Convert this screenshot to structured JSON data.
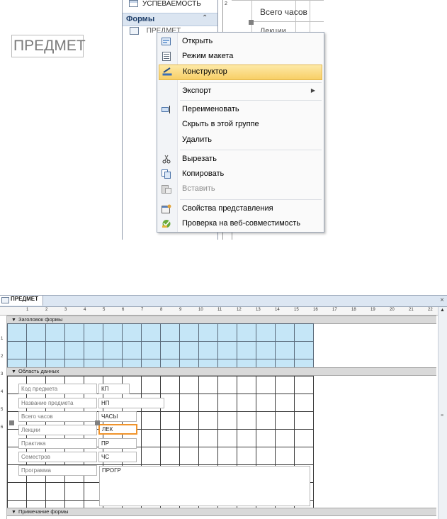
{
  "nav": {
    "table_item": "УСПЕВАЕМОСТЬ",
    "forms_header": "Формы",
    "form_item": "ПРЕДМЕТ",
    "ruler_digit": "2"
  },
  "design_preview": {
    "label_total_hours": "Всего часов",
    "label_lectures": "Лекции"
  },
  "context_menu": {
    "items": [
      {
        "label": "Открыть",
        "icon": "open-form-icon"
      },
      {
        "label": "Режим макета",
        "icon": "layout-view-icon"
      },
      {
        "label": "Конструктор",
        "icon": "design-view-icon",
        "highlighted": true
      },
      {
        "label": "Экспорт",
        "icon": "",
        "submenu": true
      },
      {
        "label": "Переименовать",
        "icon": "rename-icon"
      },
      {
        "label": "Скрыть в этой группе",
        "icon": ""
      },
      {
        "label": "Удалить",
        "icon": ""
      },
      {
        "label": "Вырезать",
        "icon": "scissors-icon"
      },
      {
        "label": "Копировать",
        "icon": "copy-icon"
      },
      {
        "label": "Вставить",
        "icon": "paste-icon",
        "disabled": true
      },
      {
        "label": "Свойства представления",
        "icon": "properties-icon"
      },
      {
        "label": "Проверка на веб-совместимость",
        "icon": "web-compat-icon"
      }
    ]
  },
  "design_window": {
    "tab_title": "ПРЕДМЕТ",
    "close": "×",
    "sections": {
      "header": "Заголовок формы",
      "detail": "Область данных",
      "footer": "Примечание формы"
    },
    "header_title": "ПРЕДМЕТ",
    "fields": [
      {
        "label": "Код предмета",
        "control": "КП"
      },
      {
        "label": "Название предмета",
        "control": "НП"
      },
      {
        "label": "Всего часов",
        "control": "ЧАСЫ"
      },
      {
        "label": "Лекции",
        "control": "ЛЕК",
        "selected": true
      },
      {
        "label": "Практика",
        "control": "ПР"
      },
      {
        "label": "Семестров",
        "control": "ЧС"
      },
      {
        "label": "Программа",
        "control": "ПРОГР"
      }
    ],
    "ruler_numbers": [
      "1",
      "2",
      "3",
      "4",
      "5",
      "6",
      "7",
      "8",
      "9",
      "10",
      "11",
      "12",
      "13",
      "14",
      "15",
      "16",
      "17",
      "18",
      "19",
      "20",
      "21",
      "22"
    ],
    "left_ruler_numbers": [
      "1",
      "2",
      "3",
      "4",
      "5",
      "6"
    ]
  },
  "colors": {
    "menu_highlight": "#f8cf66",
    "header_section_bg": "#c5e6f7",
    "selected_control_border": "#f0932b",
    "nav_header_bg": "#dbe5f1"
  }
}
